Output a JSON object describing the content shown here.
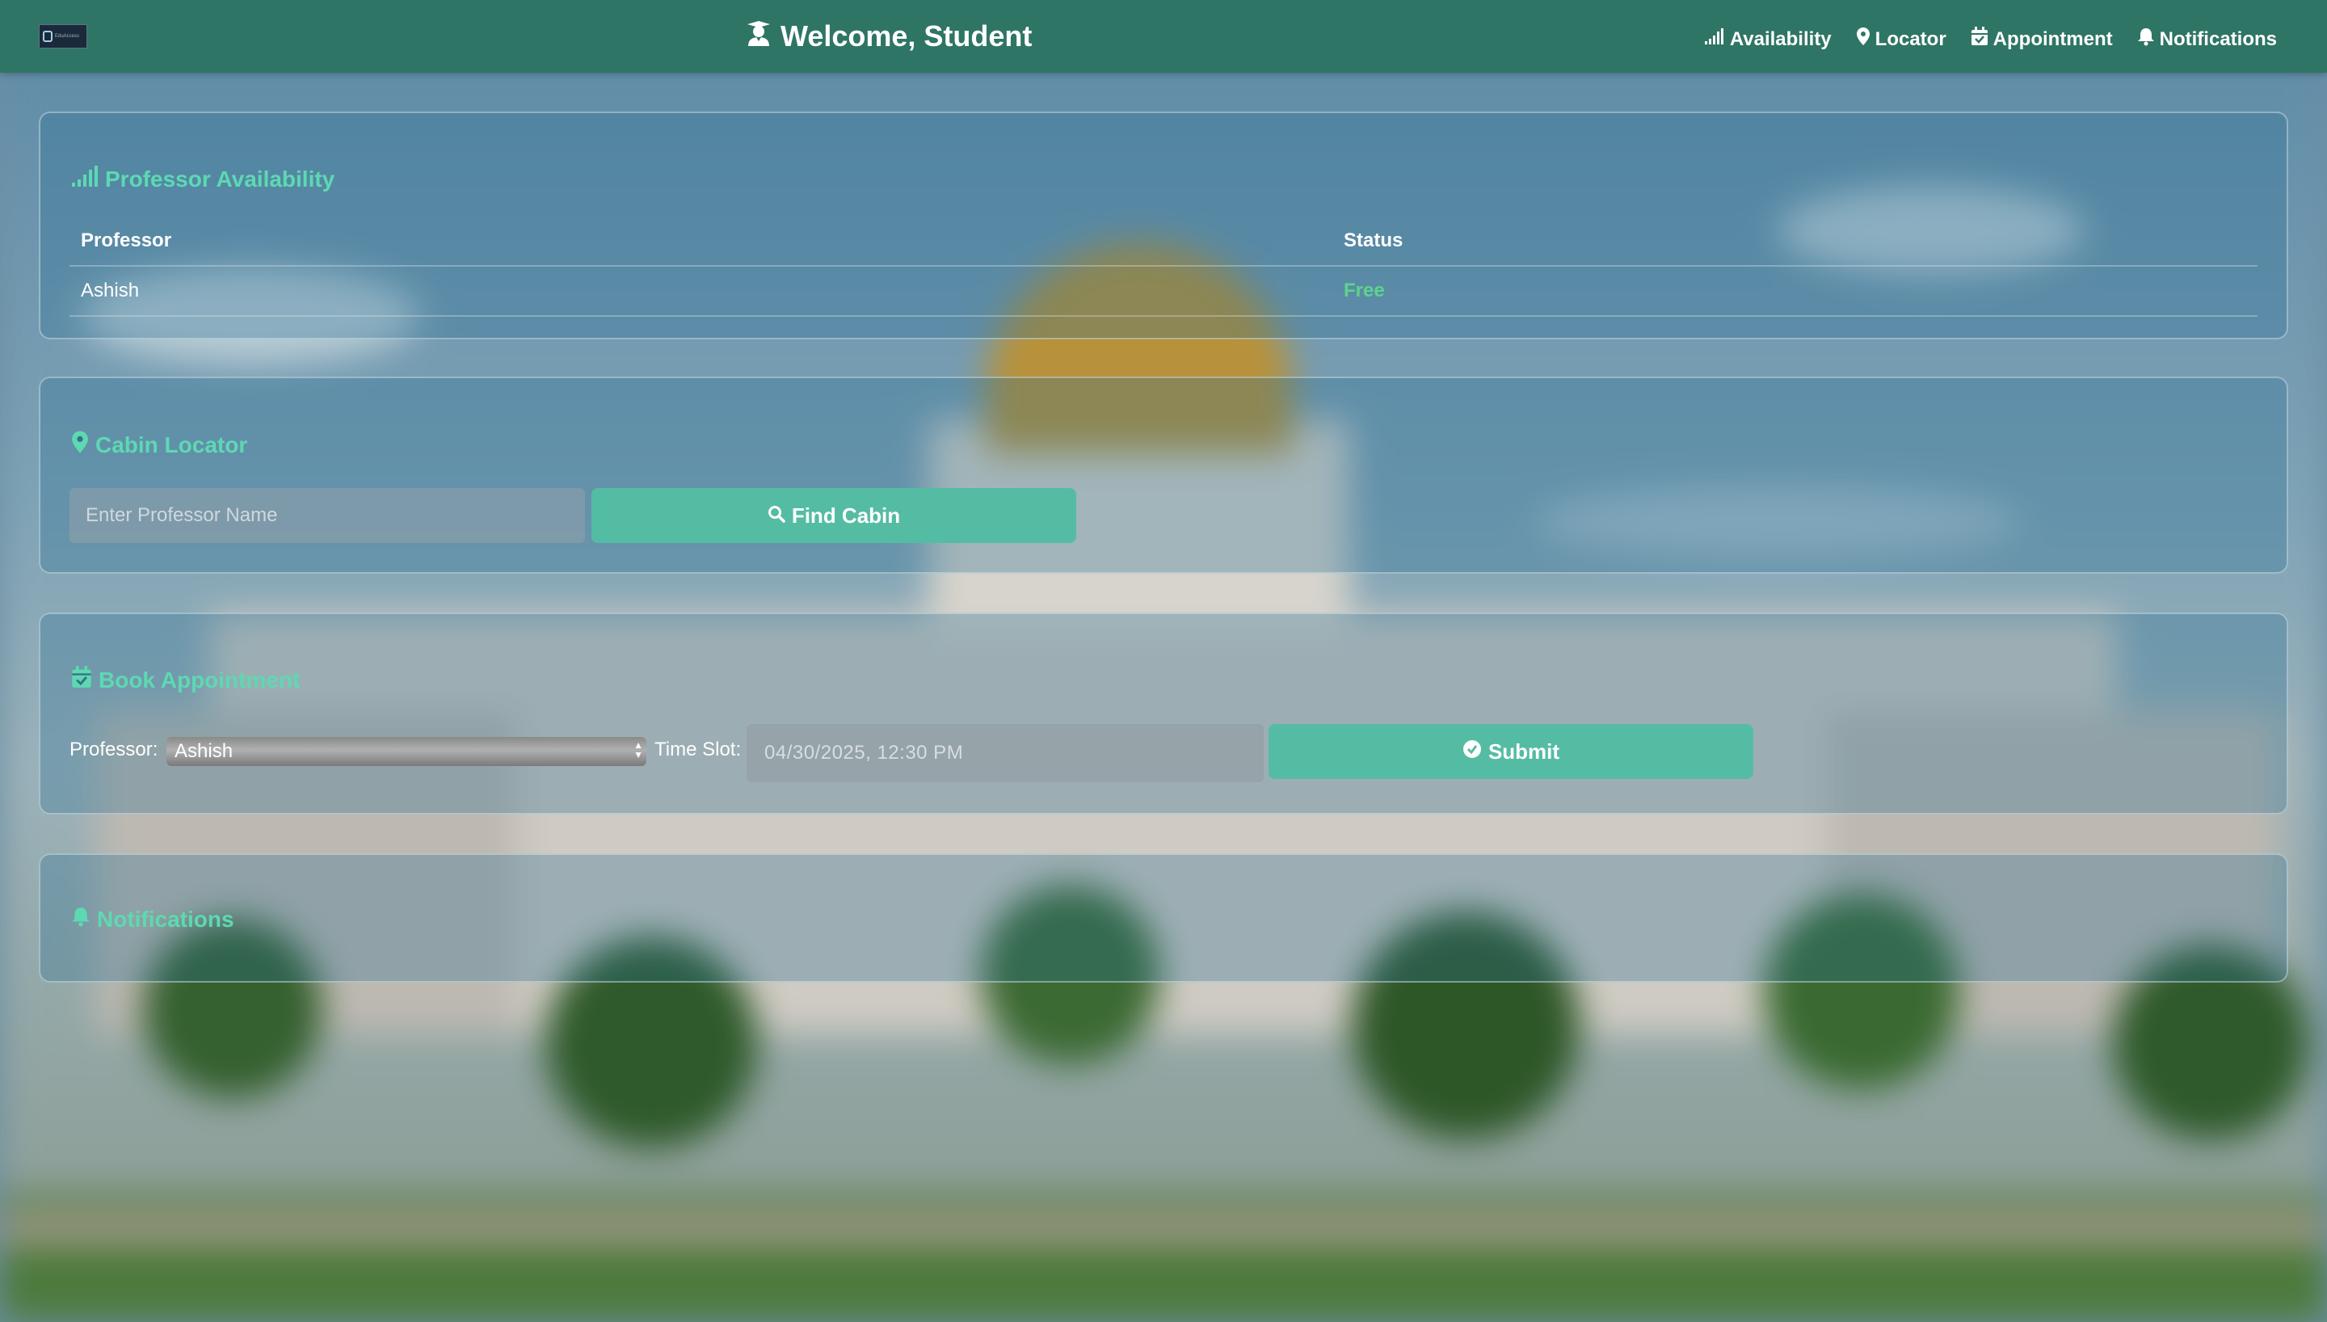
{
  "header": {
    "title": "Welcome, Student",
    "title_icon": "graduate-icon",
    "nav": [
      {
        "label": "Availability",
        "icon": "signal-bars-icon"
      },
      {
        "label": "Locator",
        "icon": "map-pin-icon"
      },
      {
        "label": "Appointment",
        "icon": "calendar-check-icon"
      },
      {
        "label": "Notifications",
        "icon": "bell-icon"
      }
    ]
  },
  "availability": {
    "heading": "Professor Availability",
    "columns": [
      "Professor",
      "Status"
    ],
    "rows": [
      {
        "professor": "Ashish",
        "status": "Free"
      }
    ]
  },
  "locator": {
    "heading": "Cabin Locator",
    "placeholder": "Enter Professor Name",
    "button_label": "Find Cabin"
  },
  "appointment": {
    "heading": "Book Appointment",
    "professor_label": "Professor:",
    "professor_value": "Ashish",
    "timeslot_label": "Time Slot:",
    "timeslot_value": "04/30/2025, 12:30 PM",
    "submit_label": "Submit"
  },
  "notifications": {
    "heading": "Notifications"
  },
  "colors": {
    "header_bg": "#2f7566",
    "accent": "#5dd9b2",
    "button": "#55bca4",
    "status_free": "#5bd48d"
  }
}
